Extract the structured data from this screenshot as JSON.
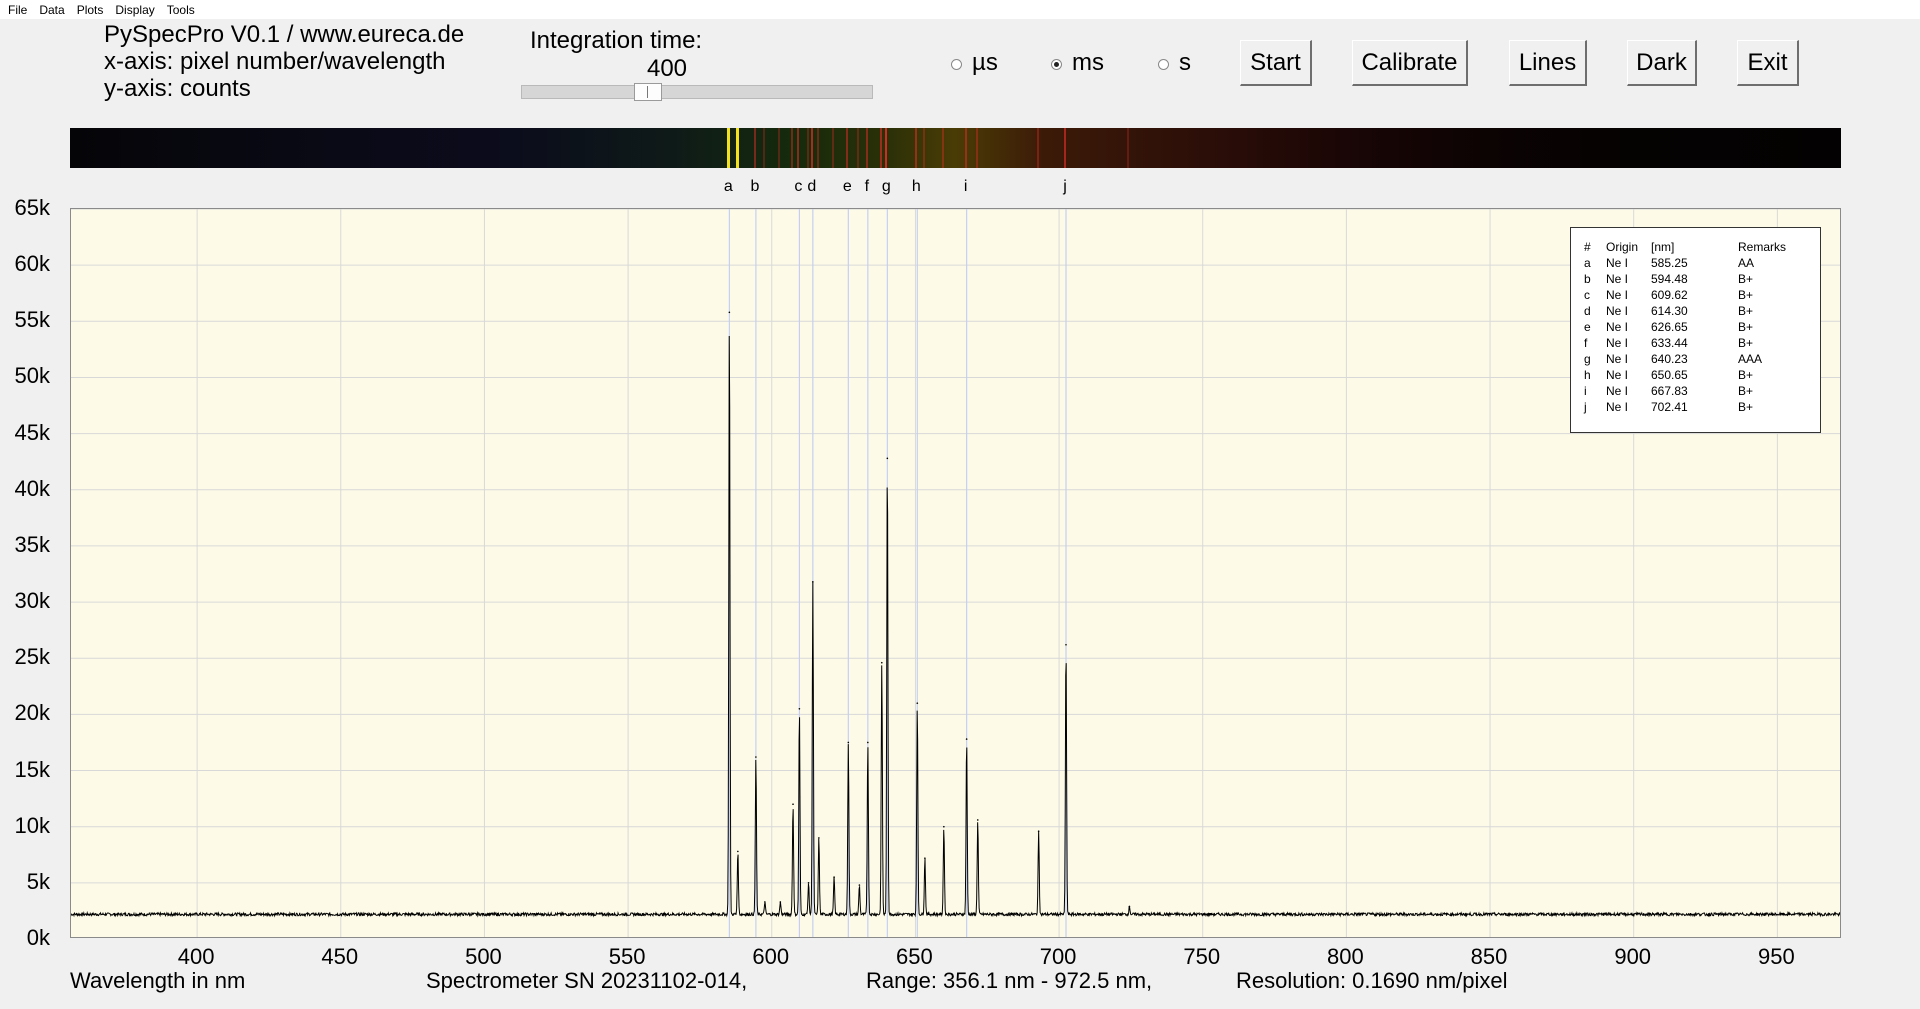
{
  "menu": [
    "File",
    "Data",
    "Plots",
    "Display",
    "Tools"
  ],
  "info": {
    "line1": "PySpecPro V0.1 / www.eureca.de",
    "line2": "x-axis: pixel number/wavelength",
    "line3": "y-axis: counts"
  },
  "integration": {
    "label": "Integration time:",
    "value": "400",
    "slider_fraction": 0.35
  },
  "units": [
    {
      "label": "µs",
      "checked": false
    },
    {
      "label": "ms",
      "checked": true
    },
    {
      "label": "s",
      "checked": false
    }
  ],
  "buttons": {
    "start": "Start",
    "calibrate": "Calibrate",
    "lines": "Lines",
    "dark": "Dark",
    "exit": "Exit"
  },
  "markers": [
    {
      "label": "a",
      "wavelength": 585.25
    },
    {
      "label": "b",
      "wavelength": 594.48
    },
    {
      "label": "c",
      "wavelength": 609.62
    },
    {
      "label": "d",
      "wavelength": 614.3
    },
    {
      "label": "e",
      "wavelength": 626.65
    },
    {
      "label": "f",
      "wavelength": 633.44
    },
    {
      "label": "g",
      "wavelength": 640.23
    },
    {
      "label": "h",
      "wavelength": 650.65
    },
    {
      "label": "i",
      "wavelength": 667.83
    },
    {
      "label": "j",
      "wavelength": 702.41
    }
  ],
  "legend": {
    "headers": [
      "#",
      "Origin",
      "[nm]",
      "Remarks"
    ],
    "rows": [
      [
        "a",
        "Ne I",
        "585.25",
        "AA"
      ],
      [
        "b",
        "Ne I",
        "594.48",
        "B+"
      ],
      [
        "c",
        "Ne I",
        "609.62",
        "B+"
      ],
      [
        "d",
        "Ne I",
        "614.30",
        "B+"
      ],
      [
        "e",
        "Ne I",
        "626.65",
        "B+"
      ],
      [
        "f",
        "Ne I",
        "633.44",
        "B+"
      ],
      [
        "g",
        "Ne I",
        "640.23",
        "AAA"
      ],
      [
        "h",
        "Ne I",
        "650.65",
        "B+"
      ],
      [
        "i",
        "Ne I",
        "667.83",
        "B+"
      ],
      [
        "j",
        "Ne I",
        "702.41",
        "B+"
      ]
    ]
  },
  "status": {
    "xlabel": "Wavelength in nm",
    "serial": "Spectrometer SN 20231102-014,",
    "range": "Range: 356.1 nm - 972.5 nm,",
    "resolution": "Resolution: 0.1690 nm/pixel"
  },
  "colors": {
    "plot_bg": "#fdfbe7",
    "marker_line": "#c5cff2",
    "grid": "#d8d8d8",
    "trace": "#000000"
  },
  "chart_data": {
    "type": "line",
    "xlabel": "Wavelength in nm",
    "ylabel": "",
    "xlim": [
      356.1,
      972.5
    ],
    "ylim": [
      0,
      65000
    ],
    "x_ticks": [
      400,
      450,
      500,
      550,
      600,
      650,
      700,
      750,
      800,
      850,
      900,
      950
    ],
    "x_tick_labels": [
      "400",
      "450",
      "500",
      "550",
      "600",
      "650",
      "700",
      "750",
      "800",
      "850",
      "900",
      "950"
    ],
    "y_ticks": [
      0,
      5000,
      10000,
      15000,
      20000,
      25000,
      30000,
      35000,
      40000,
      45000,
      50000,
      55000,
      60000,
      65000
    ],
    "y_tick_labels": [
      "0k",
      "5k",
      "10k",
      "15k",
      "20k",
      "25k",
      "30k",
      "35k",
      "40k",
      "45k",
      "50k",
      "55k",
      "60k",
      "65k"
    ],
    "grid": true,
    "baseline": 2200,
    "peaks": [
      {
        "x": 585.25,
        "y": 55800
      },
      {
        "x": 588.2,
        "y": 7800
      },
      {
        "x": 594.48,
        "y": 16200
      },
      {
        "x": 597.6,
        "y": 3300
      },
      {
        "x": 603.0,
        "y": 3300
      },
      {
        "x": 607.4,
        "y": 12000
      },
      {
        "x": 609.62,
        "y": 20500
      },
      {
        "x": 612.8,
        "y": 5000
      },
      {
        "x": 614.3,
        "y": 31800
      },
      {
        "x": 616.4,
        "y": 9000
      },
      {
        "x": 621.7,
        "y": 5500
      },
      {
        "x": 626.65,
        "y": 17500
      },
      {
        "x": 630.5,
        "y": 4800
      },
      {
        "x": 633.44,
        "y": 17500
      },
      {
        "x": 638.3,
        "y": 24600
      },
      {
        "x": 640.23,
        "y": 42800
      },
      {
        "x": 650.65,
        "y": 21000
      },
      {
        "x": 653.3,
        "y": 7200
      },
      {
        "x": 659.9,
        "y": 10000
      },
      {
        "x": 667.83,
        "y": 17800
      },
      {
        "x": 671.7,
        "y": 10600
      },
      {
        "x": 692.9,
        "y": 9600
      },
      {
        "x": 702.41,
        "y": 26200
      },
      {
        "x": 724.5,
        "y": 2900
      }
    ]
  }
}
